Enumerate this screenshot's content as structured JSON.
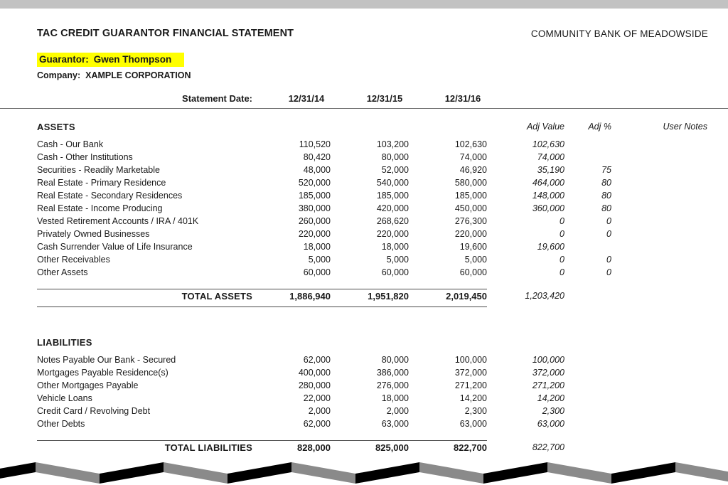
{
  "document": {
    "title": "TAC CREDIT GUARANTOR FINANCIAL STATEMENT",
    "bank_name": "COMMUNITY BANK OF MEADOWSIDE",
    "guarantor_label": "Guarantor:",
    "guarantor_name": "Gwen Thompson",
    "company_label": "Company:",
    "company_name": "XAMPLE CORPORATION",
    "highlight_color": "#ffff00"
  },
  "columns": {
    "statement_date_label": "Statement Date:",
    "dates": [
      "12/31/14",
      "12/31/15",
      "12/31/16"
    ],
    "adj_value_label": "Adj Value",
    "adj_pct_label": "Adj %",
    "user_notes_label": "User Notes"
  },
  "assets": {
    "title": "ASSETS",
    "rows": [
      {
        "label": "Cash - Our Bank",
        "c0": "110,520",
        "c1": "103,200",
        "c2": "102,630",
        "adj_value": "102,630",
        "adj_pct": "",
        "notes": ""
      },
      {
        "label": "Cash - Other Institutions",
        "c0": "80,420",
        "c1": "80,000",
        "c2": "74,000",
        "adj_value": "74,000",
        "adj_pct": "",
        "notes": ""
      },
      {
        "label": "Securities - Readily Marketable",
        "c0": "48,000",
        "c1": "52,000",
        "c2": "46,920",
        "adj_value": "35,190",
        "adj_pct": "75",
        "notes": ""
      },
      {
        "label": "Real Estate - Primary Residence",
        "c0": "520,000",
        "c1": "540,000",
        "c2": "580,000",
        "adj_value": "464,000",
        "adj_pct": "80",
        "notes": ""
      },
      {
        "label": "Real Estate - Secondary Residences",
        "c0": "185,000",
        "c1": "185,000",
        "c2": "185,000",
        "adj_value": "148,000",
        "adj_pct": "80",
        "notes": ""
      },
      {
        "label": "Real Estate - Income Producing",
        "c0": "380,000",
        "c1": "420,000",
        "c2": "450,000",
        "adj_value": "360,000",
        "adj_pct": "80",
        "notes": ""
      },
      {
        "label": "Vested Retirement Accounts / IRA / 401K",
        "c0": "260,000",
        "c1": "268,620",
        "c2": "276,300",
        "adj_value": "0",
        "adj_pct": "0",
        "notes": ""
      },
      {
        "label": "Privately Owned Businesses",
        "c0": "220,000",
        "c1": "220,000",
        "c2": "220,000",
        "adj_value": "0",
        "adj_pct": "0",
        "notes": ""
      },
      {
        "label": "Cash Surrender Value of Life Insurance",
        "c0": "18,000",
        "c1": "18,000",
        "c2": "19,600",
        "adj_value": "19,600",
        "adj_pct": "",
        "notes": ""
      },
      {
        "label": "Other Receivables",
        "c0": "5,000",
        "c1": "5,000",
        "c2": "5,000",
        "adj_value": "0",
        "adj_pct": "0",
        "notes": ""
      },
      {
        "label": "Other Assets",
        "c0": "60,000",
        "c1": "60,000",
        "c2": "60,000",
        "adj_value": "0",
        "adj_pct": "0",
        "notes": ""
      }
    ],
    "total": {
      "label": "TOTAL ASSETS",
      "c0": "1,886,940",
      "c1": "1,951,820",
      "c2": "2,019,450",
      "adj_value": "1,203,420"
    }
  },
  "liabilities": {
    "title": "LIABILITIES",
    "rows": [
      {
        "label": "Notes Payable Our Bank - Secured",
        "c0": "62,000",
        "c1": "80,000",
        "c2": "100,000",
        "adj_value": "100,000",
        "adj_pct": "",
        "notes": ""
      },
      {
        "label": "Mortgages Payable Residence(s)",
        "c0": "400,000",
        "c1": "386,000",
        "c2": "372,000",
        "adj_value": "372,000",
        "adj_pct": "",
        "notes": ""
      },
      {
        "label": "Other Mortgages Payable",
        "c0": "280,000",
        "c1": "276,000",
        "c2": "271,200",
        "adj_value": "271,200",
        "adj_pct": "",
        "notes": ""
      },
      {
        "label": "Vehicle Loans",
        "c0": "22,000",
        "c1": "18,000",
        "c2": "14,200",
        "adj_value": "14,200",
        "adj_pct": "",
        "notes": ""
      },
      {
        "label": "Credit Card / Revolving Debt",
        "c0": "2,000",
        "c1": "2,000",
        "c2": "2,300",
        "adj_value": "2,300",
        "adj_pct": "",
        "notes": ""
      },
      {
        "label": "Other Debts",
        "c0": "62,000",
        "c1": "63,000",
        "c2": "63,000",
        "adj_value": "63,000",
        "adj_pct": "",
        "notes": ""
      }
    ],
    "total": {
      "label": "TOTAL LIABILITIES",
      "c0": "828,000",
      "c1": "825,000",
      "c2": "822,700",
      "adj_value": "822,700"
    }
  },
  "decoration": {
    "top_bar_color": "#c2c2c2",
    "zigzag_dark_color": "#000000",
    "zigzag_light_color": "#8a8a8a"
  }
}
